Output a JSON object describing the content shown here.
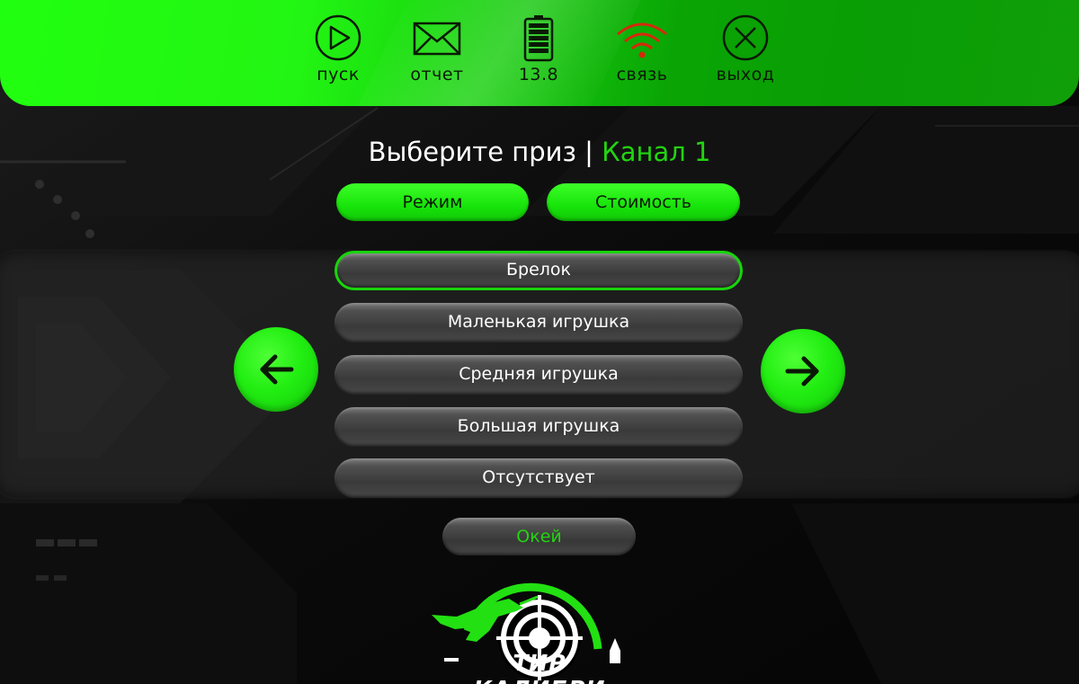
{
  "toolbar": {
    "items": [
      {
        "label": "пуск",
        "icon": "play-icon"
      },
      {
        "label": "отчет",
        "icon": "mail-icon"
      },
      {
        "label": "13.8",
        "icon": "battery-icon"
      },
      {
        "label": "связь",
        "icon": "wifi-icon"
      },
      {
        "label": "выход",
        "icon": "close-circle-icon"
      }
    ]
  },
  "title": {
    "main": "Выберите приз | ",
    "accent": "Канал 1"
  },
  "tabs": {
    "mode": "Режим",
    "cost": "Стоимость"
  },
  "prizes": {
    "selected_index": 0,
    "items": [
      "Брелок",
      "Маленькая игрушка",
      "Средняя игрушка",
      "Большая игрушка",
      "Отсутствует"
    ]
  },
  "ok_label": "Окей",
  "logo_text": "ТИР КАЛИБРИ",
  "colors": {
    "accent": "#22d410",
    "topbar": "#18d90c",
    "wifi": "#d42a0c"
  }
}
